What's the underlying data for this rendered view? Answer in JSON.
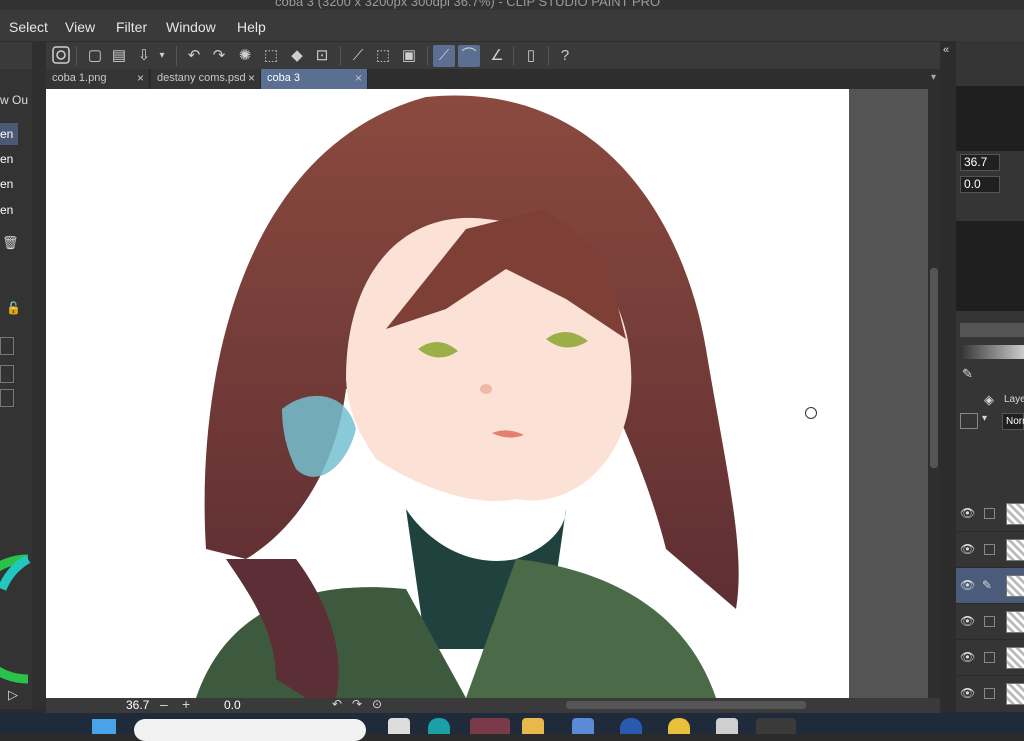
{
  "window": {
    "title": "coba 3 (3200 x 3200px 300dpi 36.7%) - CLIP STUDIO PAINT PRO"
  },
  "menu": [
    "Select",
    "View",
    "Filter",
    "Window",
    "Help"
  ],
  "tabs": [
    {
      "label": "coba 1.png"
    },
    {
      "label": "destany coms.psd"
    },
    {
      "label": "coba 3"
    }
  ],
  "tab_close": "×",
  "left_panel": {
    "header": "w Ou",
    "items": [
      "en",
      "en",
      "en",
      "en"
    ]
  },
  "status": {
    "zoom": "36.7",
    "angle": "0.0",
    "minus": "–",
    "plus": "+"
  },
  "right_panel": {
    "zoom_value": "36.7",
    "rotate_value": "0.0",
    "layer_tab": "Laye",
    "blend_mode": "Norm"
  },
  "colors": {
    "accent": "#5a6f92",
    "canvas": "#ffffff",
    "panel": "#353535"
  },
  "icons": [
    "new-canvas-icon",
    "open-icon",
    "save-icon",
    "undo-icon",
    "redo-icon",
    "loading-icon",
    "clear-icon",
    "fill-icon",
    "transform-icon",
    "snap-ruler-icon",
    "snap-special-icon",
    "snap-grid-icon",
    "pen-stabilizer-icon",
    "device-icon",
    "help-icon"
  ]
}
